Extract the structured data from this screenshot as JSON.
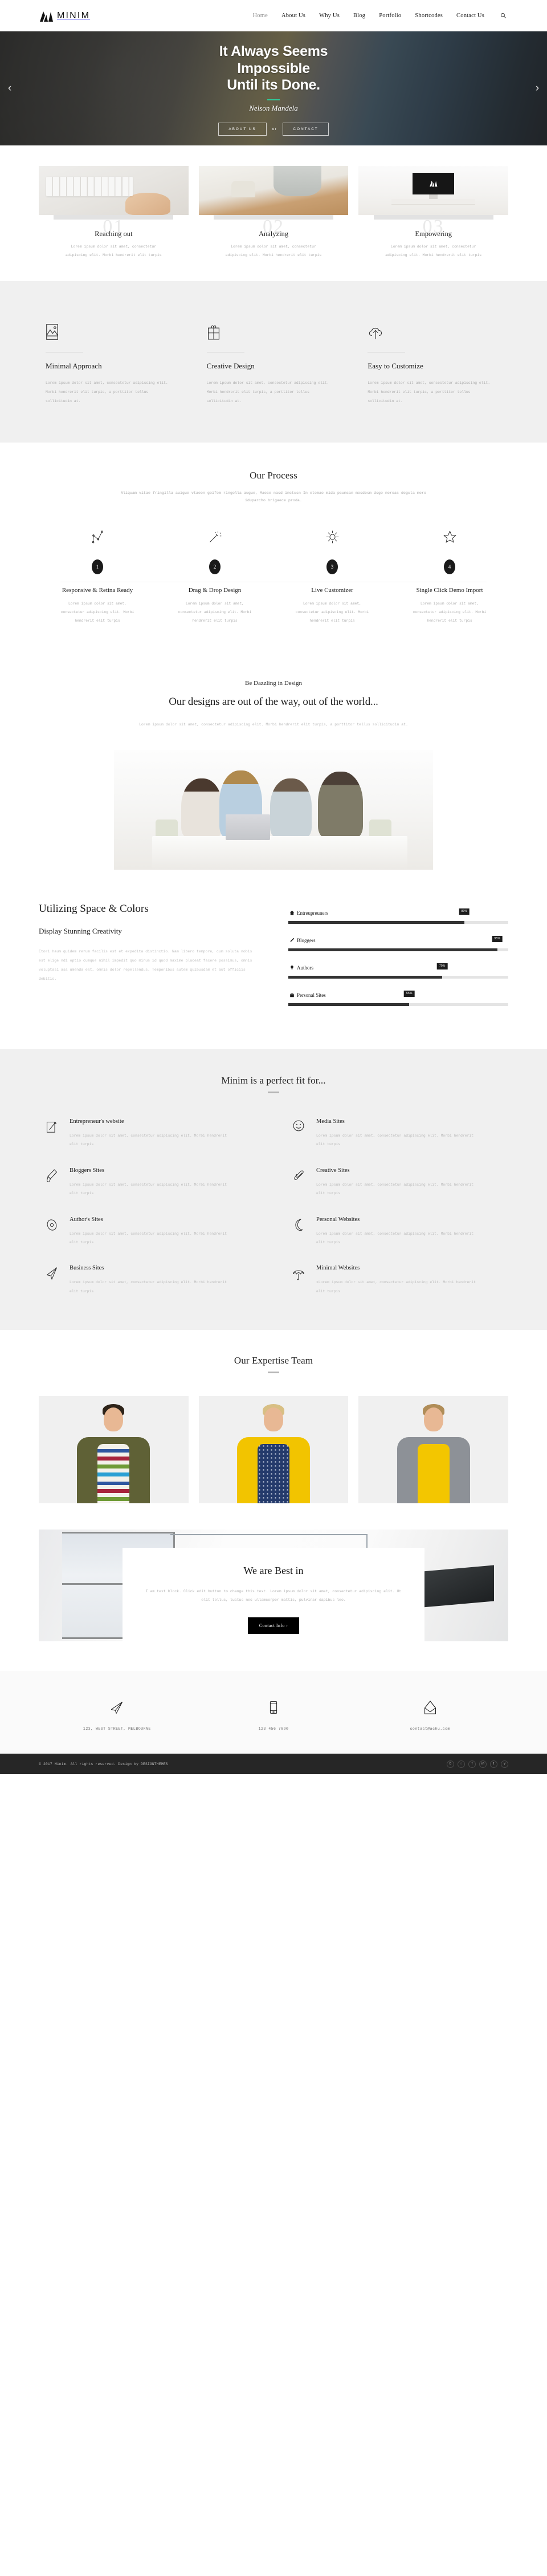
{
  "header": {
    "brand": "MINIM",
    "nav": [
      {
        "label": "Home",
        "active": true
      },
      {
        "label": "About Us",
        "active": false
      },
      {
        "label": "Why Us",
        "active": false
      },
      {
        "label": "Blog",
        "active": false
      },
      {
        "label": "Portfolio",
        "active": false
      },
      {
        "label": "Shortcodes",
        "active": false
      },
      {
        "label": "Contact Us",
        "active": false
      }
    ],
    "search_icon": "search-icon"
  },
  "hero": {
    "line1": "It Always Seems",
    "line2": "Impossible",
    "line3": "Until its Done.",
    "author": "Nelson Mandela",
    "btn_primary": "ABOUT US",
    "or": "or",
    "btn_secondary": "CONTACT",
    "prev": "‹",
    "next": "›",
    "accent_color": "#2ecc9a"
  },
  "steps": [
    {
      "number": "01",
      "title": "Reaching out",
      "desc": "Lorem ipsum dolor sit amet, consectetur adipiscing elit. Morbi hendrerit elit turpis"
    },
    {
      "number": "02",
      "title": "Analyzing",
      "desc": "Lorem ipsum dolor sit amet, consectetur adipiscing elit. Morbi hendrerit elit turpis"
    },
    {
      "number": "03",
      "title": "Empowering",
      "desc": "Lorem ipsum dolor sit amet, consectetur adipiscing elit. Morbi hendrerit elit turpis"
    }
  ],
  "features": [
    {
      "icon": "image-icon",
      "title": "Minimal Approach",
      "desc": "Lorem ipsum dolor sit amet, consectetur adipiscing elit. Morbi hendrerit elit turpis, a porttitor tellus sollicitudin at."
    },
    {
      "icon": "gift-icon",
      "title": "Creative Design",
      "desc": "Lorem ipsum dolor sit amet, consectetur adipiscing elit. Morbi hendrerit elit turpis, a porttitor tellus sollicitudin at."
    },
    {
      "icon": "cloud-upload-icon",
      "title": "Easy to Customize",
      "desc": "Lorem ipsum dolor sit amet, consectetur adipiscing elit. Morbi hendrerit elit turpis, a porttitor tellus sollicitudin at."
    }
  ],
  "process": {
    "title": "Our Process",
    "subtitle": "Aliquam vitae fringilla auigue vtaeon goifom ringolla augue, Maece nasd inctusn In etomao mida pcumsan mosdesm dsgo neroas deguta mero iduparcho brigaece proda.",
    "steps": [
      {
        "icon": "chart-line-icon",
        "number": "1",
        "title": "Responsive & Retina Ready",
        "desc": "Lorem ipsum dolor sit amet, consectetur adipiscing elit. Morbi hendrerit elit turpis"
      },
      {
        "icon": "magic-wand-icon",
        "number": "2",
        "title": "Drag & Drop Design",
        "desc": "Lorem ipsum dolor sit amet, consectetur adipiscing elit. Morbi hendrerit elit turpis"
      },
      {
        "icon": "sun-icon",
        "number": "3",
        "title": "Live Customizer",
        "desc": "Lorem ipsum dolor sit amet, consectetur adipiscing elit. Morbi hendrerit elit turpis"
      },
      {
        "icon": "star-icon",
        "number": "4",
        "title": "Single Click Demo Import",
        "desc": "Lorem ipsum dolor sit amet, consectetur adipiscing elit. Morbi hendrerit elit turpis"
      }
    ]
  },
  "dazzle": {
    "kicker": "Be Dazzling in Design",
    "heading": "Our designs are out of the way, out of the world...",
    "desc": "Lorem ipsum dolor sit amet, consectetur adipiscing elit. Morbi hendrerit elit turpis, a porttitor tellus sollicitudin at."
  },
  "skills": {
    "title": "Utilizing Space & Colors",
    "subtitle": "Display Stunning Creativity",
    "paragraph": "Etori haum quidem rerum facilis est et expedita distinctio. Nam libero tempore, cum soluta nobis est elige ndi optio cumque nihil impedit quo minus id quod maxime placeat facere possimus, omnis voluptasi asa umenda est, omnis dolor repellendus. Temporibus autem quibusdam et aut officiis debitis.",
    "bars": [
      {
        "icon": "home-icon",
        "label": "Entreupreuners",
        "value": 80,
        "pct": "80%"
      },
      {
        "icon": "pencil-icon",
        "label": "Bloggers",
        "value": 95,
        "pct": "95%"
      },
      {
        "icon": "bulb-icon",
        "label": "Authors",
        "value": 70,
        "pct": "70%"
      },
      {
        "icon": "gift-icon",
        "label": "Personal Sites",
        "value": 55,
        "pct": "55%"
      }
    ]
  },
  "fitfor": {
    "title": "Minim is a perfect fit for...",
    "items": [
      {
        "icon": "notepad-pencil-icon",
        "title": "Entrepreneur's website",
        "desc": "Lorem ipsum dolor sit amet, consectetur adipiscing elit. Morbi hendrerit elit turpis"
      },
      {
        "icon": "smiley-icon",
        "title": "Media Sites",
        "desc": "Lorem ipsum dolor sit amet, consectetur adipiscing elit. Morbi hendrerit elit turpis"
      },
      {
        "icon": "paintbrush-icon",
        "title": "Bloggers Sites",
        "desc": "Lorem ipsum dolor sit amet, consectetur adipiscing elit. Morbi hendrerit elit turpis"
      },
      {
        "icon": "paperclip-icon",
        "title": "Creative Sites",
        "desc": "Lorem ipsum dolor sit amet, consectetur adipiscing elit. Morbi hendrerit elit turpis"
      },
      {
        "icon": "compass-icon",
        "title": "Author's Sites",
        "desc": "Lorem ipsum dolor sit amet, consectetur adipiscing elit. Morbi hendrerit elit turpis"
      },
      {
        "icon": "moon-icon",
        "title": "Personal Websites",
        "desc": "Lorem ipsum dolor sit amet, consectetur adipiscing elit. Morbi hendrerit elit turpis"
      },
      {
        "icon": "paper-plane-icon",
        "title": "Business Sites",
        "desc": "Lorem ipsum dolor sit amet, consectetur adipiscing elit. Morbi hendrerit elit turpis"
      },
      {
        "icon": "umbrella-icon",
        "title": "Minimal Websites",
        "desc": "xLorem ipsum dolor sit amet, consectetur adipiscing elit. Morbi hendrerit elit turpis"
      }
    ]
  },
  "team": {
    "title": "Our Expertise Team",
    "members": [
      {
        "name": "team-member-1"
      },
      {
        "name": "team-member-2"
      },
      {
        "name": "team-member-3"
      }
    ]
  },
  "bestin": {
    "title": "We are Best in",
    "desc": "I am text block. Click edit button to change this text. Lorem ipsum dolor sit amet, consectetur adipiscing elit. Ut elit tellus, luctus nec ullamcorper mattis, pulvinar dapibus leo.",
    "button": "Contact Info  ›"
  },
  "contact": [
    {
      "icon": "paper-plane-icon",
      "text": "123, WEST STREET, MELBOURNE"
    },
    {
      "icon": "mobile-icon",
      "text": "123 456 7890"
    },
    {
      "icon": "envelope-icon",
      "text": "contact@achu.com"
    }
  ],
  "footer": {
    "copyright": "© 2017 Minim. All rights reserved. Design by DESIGNTHEMES",
    "social": [
      {
        "name": "behance-icon",
        "glyph": "ƀ"
      },
      {
        "name": "dribbble-icon",
        "glyph": "◌"
      },
      {
        "name": "facebook-icon",
        "glyph": "f"
      },
      {
        "name": "linkedin-icon",
        "glyph": "in"
      },
      {
        "name": "tumblr-icon",
        "glyph": "t"
      },
      {
        "name": "twitter-icon",
        "glyph": "ᴠ"
      }
    ]
  }
}
